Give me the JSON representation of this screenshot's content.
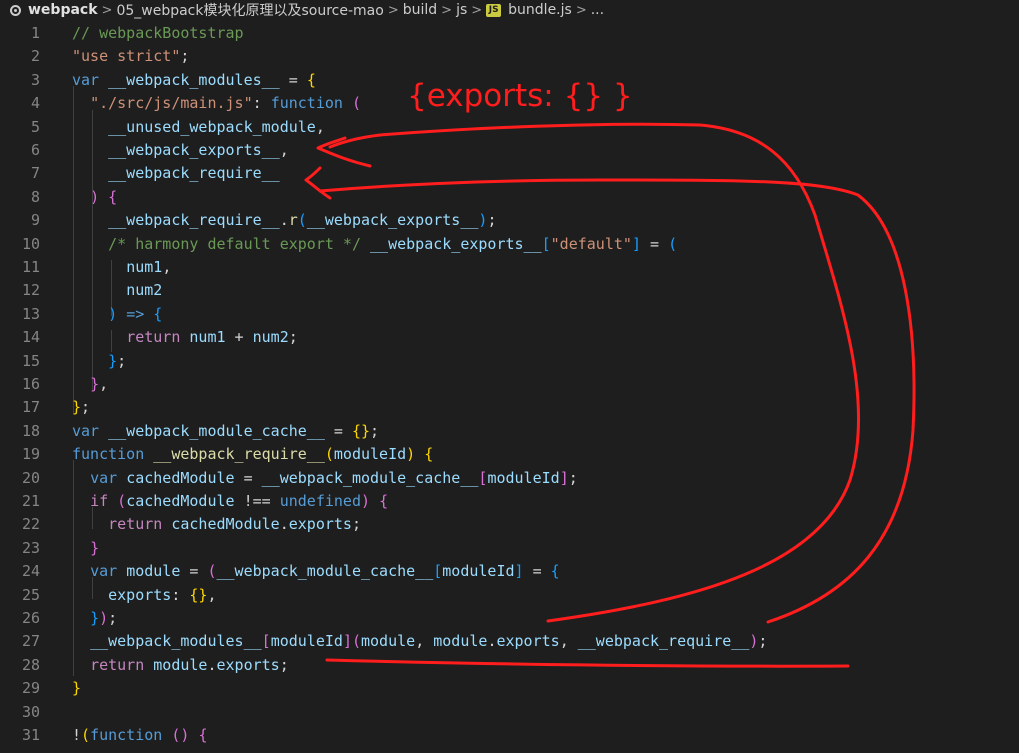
{
  "breadcrumb": {
    "items": [
      "webpack",
      "05_webpack模块化原理以及source-mao",
      "build",
      "js",
      "bundle.js",
      "..."
    ],
    "separator": ">"
  },
  "annotation": {
    "text": "{exports: {} }",
    "color": "#ff1d1d"
  },
  "colors": {
    "background": "#1e1e1e",
    "comment": "#6a9955",
    "string": "#ce9178",
    "keyword": "#569cd6",
    "variable": "#9cdcfe",
    "function": "#dcdcaa",
    "control": "#c586c0",
    "annotation_ink": "#ff1d1d"
  },
  "lines": [
    {
      "n": "1",
      "tokens": [
        [
          "c",
          "// webpackBootstrap"
        ]
      ]
    },
    {
      "n": "2",
      "tokens": [
        [
          "s",
          "\"use strict\""
        ],
        [
          "t",
          ";"
        ]
      ]
    },
    {
      "n": "3",
      "tokens": [
        [
          "k",
          "var"
        ],
        [
          "t",
          " "
        ],
        [
          "v",
          "__webpack_modules__"
        ],
        [
          "t",
          " = "
        ],
        [
          "b1",
          "{"
        ]
      ]
    },
    {
      "n": "4",
      "tokens": [
        [
          "t",
          "  "
        ],
        [
          "s",
          "\"./src/js/main.js\""
        ],
        [
          "t",
          ": "
        ],
        [
          "k",
          "function"
        ],
        [
          "t",
          " "
        ],
        [
          "b2",
          "("
        ]
      ]
    },
    {
      "n": "5",
      "tokens": [
        [
          "t",
          "    "
        ],
        [
          "v",
          "__unused_webpack_module"
        ],
        [
          "t",
          ","
        ]
      ]
    },
    {
      "n": "6",
      "tokens": [
        [
          "t",
          "    "
        ],
        [
          "v",
          "__webpack_exports__"
        ],
        [
          "t",
          ","
        ]
      ]
    },
    {
      "n": "7",
      "tokens": [
        [
          "t",
          "    "
        ],
        [
          "v",
          "__webpack_require__"
        ]
      ]
    },
    {
      "n": "8",
      "tokens": [
        [
          "t",
          "  "
        ],
        [
          "b2",
          ")"
        ],
        [
          "t",
          " "
        ],
        [
          "b2",
          "{"
        ]
      ]
    },
    {
      "n": "9",
      "tokens": [
        [
          "t",
          "    "
        ],
        [
          "v",
          "__webpack_require__"
        ],
        [
          "t",
          "."
        ],
        [
          "f",
          "r"
        ],
        [
          "b3",
          "("
        ],
        [
          "v",
          "__webpack_exports__"
        ],
        [
          "b3",
          ")"
        ],
        [
          "t",
          ";"
        ]
      ]
    },
    {
      "n": "10",
      "tokens": [
        [
          "t",
          "    "
        ],
        [
          "c",
          "/* harmony default export */"
        ],
        [
          "t",
          " "
        ],
        [
          "v",
          "__webpack_exports__"
        ],
        [
          "b3",
          "["
        ],
        [
          "s",
          "\"default\""
        ],
        [
          "b3",
          "]"
        ],
        [
          "t",
          " = "
        ],
        [
          "b3",
          "("
        ]
      ]
    },
    {
      "n": "11",
      "tokens": [
        [
          "t",
          "      "
        ],
        [
          "v",
          "num1"
        ],
        [
          "t",
          ","
        ]
      ]
    },
    {
      "n": "12",
      "tokens": [
        [
          "t",
          "      "
        ],
        [
          "v",
          "num2"
        ]
      ]
    },
    {
      "n": "13",
      "tokens": [
        [
          "t",
          "    "
        ],
        [
          "b3",
          ")"
        ],
        [
          "t",
          " "
        ],
        [
          "k",
          "=>"
        ],
        [
          "t",
          " "
        ],
        [
          "b3",
          "{"
        ]
      ]
    },
    {
      "n": "14",
      "tokens": [
        [
          "t",
          "      "
        ],
        [
          "p",
          "return"
        ],
        [
          "t",
          " "
        ],
        [
          "v",
          "num1"
        ],
        [
          "t",
          " + "
        ],
        [
          "v",
          "num2"
        ],
        [
          "t",
          ";"
        ]
      ]
    },
    {
      "n": "15",
      "tokens": [
        [
          "t",
          "    "
        ],
        [
          "b3",
          "}"
        ],
        [
          "t",
          ";"
        ]
      ]
    },
    {
      "n": "16",
      "tokens": [
        [
          "t",
          "  "
        ],
        [
          "b2",
          "}"
        ],
        [
          "t",
          ","
        ]
      ]
    },
    {
      "n": "17",
      "tokens": [
        [
          "b1",
          "}"
        ],
        [
          "t",
          ";"
        ]
      ]
    },
    {
      "n": "18",
      "tokens": [
        [
          "k",
          "var"
        ],
        [
          "t",
          " "
        ],
        [
          "v",
          "__webpack_module_cache__"
        ],
        [
          "t",
          " = "
        ],
        [
          "b1",
          "{}"
        ],
        [
          "t",
          ";"
        ]
      ]
    },
    {
      "n": "19",
      "tokens": [
        [
          "k",
          "function"
        ],
        [
          "t",
          " "
        ],
        [
          "f",
          "__webpack_require__"
        ],
        [
          "b1",
          "("
        ],
        [
          "v",
          "moduleId"
        ],
        [
          "b1",
          ")"
        ],
        [
          "t",
          " "
        ],
        [
          "b1",
          "{"
        ]
      ]
    },
    {
      "n": "20",
      "tokens": [
        [
          "t",
          "  "
        ],
        [
          "k",
          "var"
        ],
        [
          "t",
          " "
        ],
        [
          "v",
          "cachedModule"
        ],
        [
          "t",
          " = "
        ],
        [
          "v",
          "__webpack_module_cache__"
        ],
        [
          "b2",
          "["
        ],
        [
          "v",
          "moduleId"
        ],
        [
          "b2",
          "]"
        ],
        [
          "t",
          ";"
        ]
      ]
    },
    {
      "n": "21",
      "tokens": [
        [
          "t",
          "  "
        ],
        [
          "p",
          "if"
        ],
        [
          "t",
          " "
        ],
        [
          "b2",
          "("
        ],
        [
          "v",
          "cachedModule"
        ],
        [
          "t",
          " !== "
        ],
        [
          "k",
          "undefined"
        ],
        [
          "b2",
          ")"
        ],
        [
          "t",
          " "
        ],
        [
          "b2",
          "{"
        ]
      ]
    },
    {
      "n": "22",
      "tokens": [
        [
          "t",
          "    "
        ],
        [
          "p",
          "return"
        ],
        [
          "t",
          " "
        ],
        [
          "v",
          "cachedModule"
        ],
        [
          "t",
          "."
        ],
        [
          "v",
          "exports"
        ],
        [
          "t",
          ";"
        ]
      ]
    },
    {
      "n": "23",
      "tokens": [
        [
          "t",
          "  "
        ],
        [
          "b2",
          "}"
        ]
      ]
    },
    {
      "n": "24",
      "tokens": [
        [
          "t",
          "  "
        ],
        [
          "k",
          "var"
        ],
        [
          "t",
          " "
        ],
        [
          "v",
          "module"
        ],
        [
          "t",
          " = "
        ],
        [
          "b2",
          "("
        ],
        [
          "v",
          "__webpack_module_cache__"
        ],
        [
          "b3",
          "["
        ],
        [
          "v",
          "moduleId"
        ],
        [
          "b3",
          "]"
        ],
        [
          "t",
          " = "
        ],
        [
          "b3",
          "{"
        ]
      ]
    },
    {
      "n": "25",
      "tokens": [
        [
          "t",
          "    "
        ],
        [
          "v",
          "exports"
        ],
        [
          "t",
          ": "
        ],
        [
          "b1",
          "{}"
        ],
        [
          "t",
          ","
        ]
      ]
    },
    {
      "n": "26",
      "tokens": [
        [
          "t",
          "  "
        ],
        [
          "b3",
          "}"
        ],
        [
          "b2",
          ")"
        ],
        [
          "t",
          ";"
        ]
      ]
    },
    {
      "n": "27",
      "tokens": [
        [
          "t",
          "  "
        ],
        [
          "v",
          "__webpack_modules__"
        ],
        [
          "b2",
          "["
        ],
        [
          "v",
          "moduleId"
        ],
        [
          "b2",
          "]"
        ],
        [
          "b2",
          "("
        ],
        [
          "v",
          "module"
        ],
        [
          "t",
          ", "
        ],
        [
          "v",
          "module"
        ],
        [
          "t",
          "."
        ],
        [
          "v",
          "exports"
        ],
        [
          "t",
          ", "
        ],
        [
          "v",
          "__webpack_require__"
        ],
        [
          "b2",
          ")"
        ],
        [
          "t",
          ";"
        ]
      ]
    },
    {
      "n": "28",
      "tokens": [
        [
          "t",
          "  "
        ],
        [
          "p",
          "return"
        ],
        [
          "t",
          " "
        ],
        [
          "v",
          "module"
        ],
        [
          "t",
          "."
        ],
        [
          "v",
          "exports"
        ],
        [
          "t",
          ";"
        ]
      ]
    },
    {
      "n": "29",
      "tokens": [
        [
          "b1",
          "}"
        ]
      ]
    },
    {
      "n": "30",
      "tokens": []
    },
    {
      "n": "31",
      "tokens": [
        [
          "t",
          "!"
        ],
        [
          "b1",
          "("
        ],
        [
          "k",
          "function"
        ],
        [
          "t",
          " "
        ],
        [
          "b2",
          "()"
        ],
        [
          "t",
          " "
        ],
        [
          "b2",
          "{"
        ]
      ]
    }
  ]
}
